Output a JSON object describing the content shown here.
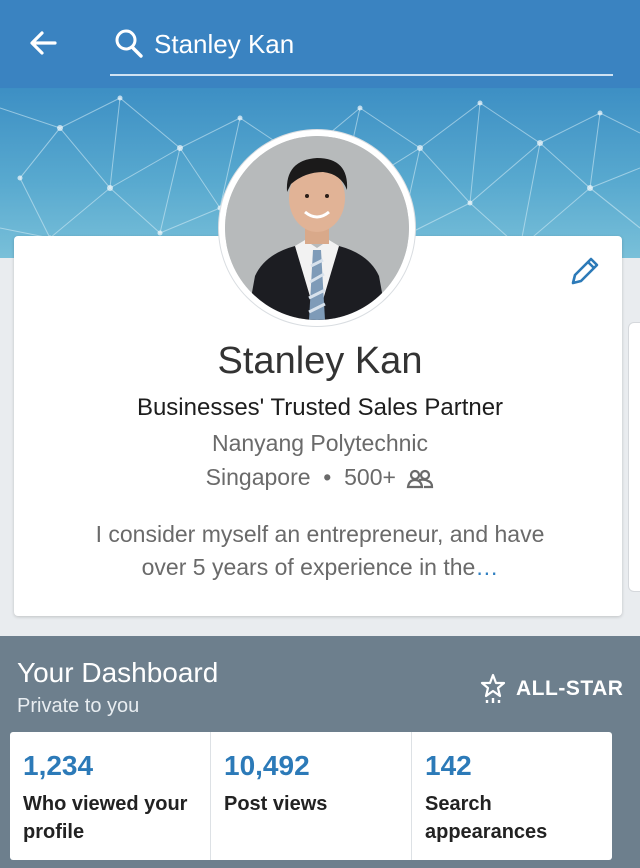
{
  "search": {
    "query": "Stanley Kan"
  },
  "profile": {
    "name": "Stanley Kan",
    "headline": "Businesses' Trusted Sales Partner",
    "school": "Nanyang Polytechnic",
    "location": "Singapore",
    "connections": "500+",
    "summary": "I consider myself an entrepreneur, and have over 5 years of experience in the",
    "summary_more": "…"
  },
  "dashboard": {
    "title": "Your Dashboard",
    "subtitle": "Private to you",
    "badge": "ALL-STAR",
    "stats": [
      {
        "value": "1,234",
        "label": "Who viewed your profile"
      },
      {
        "value": "10,492",
        "label": "Post views"
      },
      {
        "value": "142",
        "label": "Search appearances"
      }
    ]
  },
  "colors": {
    "header": "#3a83c1",
    "accent": "#2c7ab8",
    "dashboard_bg": "#6d7f8d"
  },
  "icons": [
    "back-arrow-icon",
    "search-icon",
    "pencil-icon",
    "connections-icon",
    "all-star-icon"
  ]
}
